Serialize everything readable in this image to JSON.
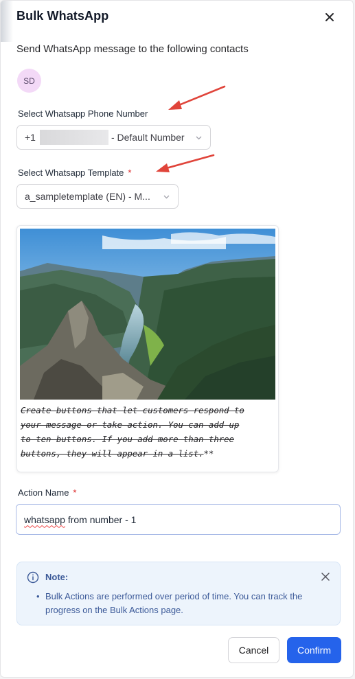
{
  "dialog": {
    "title": "Bulk WhatsApp",
    "subtitle": "Send WhatsApp message to the following contacts"
  },
  "contacts": [
    {
      "initials": "SD"
    }
  ],
  "phone_number": {
    "label": "Select Whatsapp Phone Number",
    "prefix": "+1",
    "suffix": "- Default Number"
  },
  "template": {
    "label": "Select Whatsapp Template",
    "required_mark": "*",
    "selected": "a_sampletemplate (EN) - M..."
  },
  "preview": {
    "image_description": "mountain-fjord-landscape",
    "lines": [
      "Create buttons that let customers respond to",
      "your message or take action. You can add up",
      "to ten buttons. If you add more than three",
      "buttons, they will appear in a list."
    ],
    "trailing": "**"
  },
  "action_name": {
    "label": "Action Name",
    "required_mark": "*",
    "value_word": "whatsapp",
    "value_rest": " from number - 1"
  },
  "note": {
    "title": "Note:",
    "bullet": "•",
    "text": "Bulk Actions are performed over period of time. You can track the progress on the Bulk Actions page."
  },
  "buttons": {
    "cancel": "Cancel",
    "confirm": "Confirm"
  },
  "colors": {
    "primary": "#2563eb",
    "annotation_arrow": "#e0443a",
    "note_bg": "#edf4fc",
    "note_text": "#3b5998",
    "avatar_bg": "#f3d9f7",
    "required": "#dc2626"
  },
  "icons": {
    "close": "close-icon",
    "chevron": "chevron-down-icon",
    "info": "info-circle-icon"
  }
}
